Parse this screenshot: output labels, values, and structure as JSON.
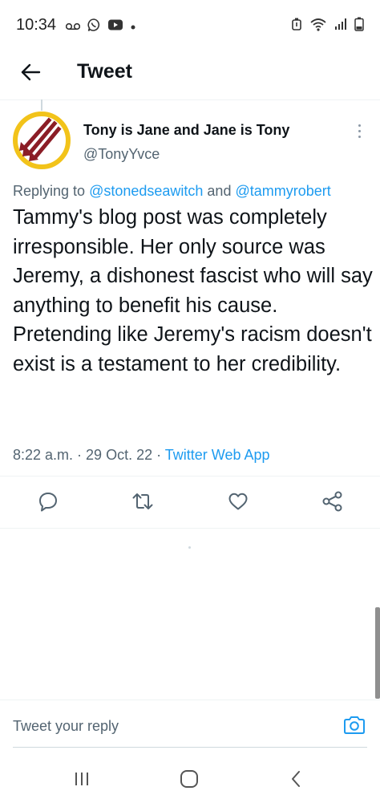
{
  "status_bar": {
    "time": "10:34",
    "left_icons": [
      "voicemail-icon",
      "whatsapp-icon",
      "youtube-icon",
      "dot-icon"
    ],
    "right_icons": [
      "alarm-icon",
      "wifi-icon",
      "signal-icon",
      "battery-icon"
    ]
  },
  "header": {
    "title": "Tweet",
    "back_icon": "arrow-left-icon"
  },
  "tweet": {
    "display_name": "Tony is Jane and Jane is Tony",
    "handle": "@TonyYvce",
    "replying_prefix": "Replying to ",
    "reply_user_1": "@stonedseawitch",
    "reply_connector": " and ",
    "reply_user_2": "@tammyrobert",
    "text_p1": "Tammy's blog post was completely irresponsible. Her only source was Jeremy, a dishonest fascist who will say anything to benefit his cause.",
    "text_p2": "Pretending like Jeremy's racism doesn't exist is a testament to her credibility.",
    "time": "8:22 a.m.",
    "date": "29 Oct. 22",
    "separator": " · ",
    "source": "Twitter Web App"
  },
  "actions": [
    "reply-icon",
    "retweet-icon",
    "like-icon",
    "share-icon"
  ],
  "reply_bar": {
    "placeholder": "Tweet your reply",
    "camera_icon": "camera-icon"
  },
  "nav_bar": [
    "recent-apps-icon",
    "home-icon",
    "back-icon"
  ],
  "colors": {
    "accent": "#1d9bf0",
    "text": "#0f1419",
    "secondary": "#536471",
    "avatar_ring": "#f2c31a",
    "avatar_arrows": "#8b1d26"
  }
}
